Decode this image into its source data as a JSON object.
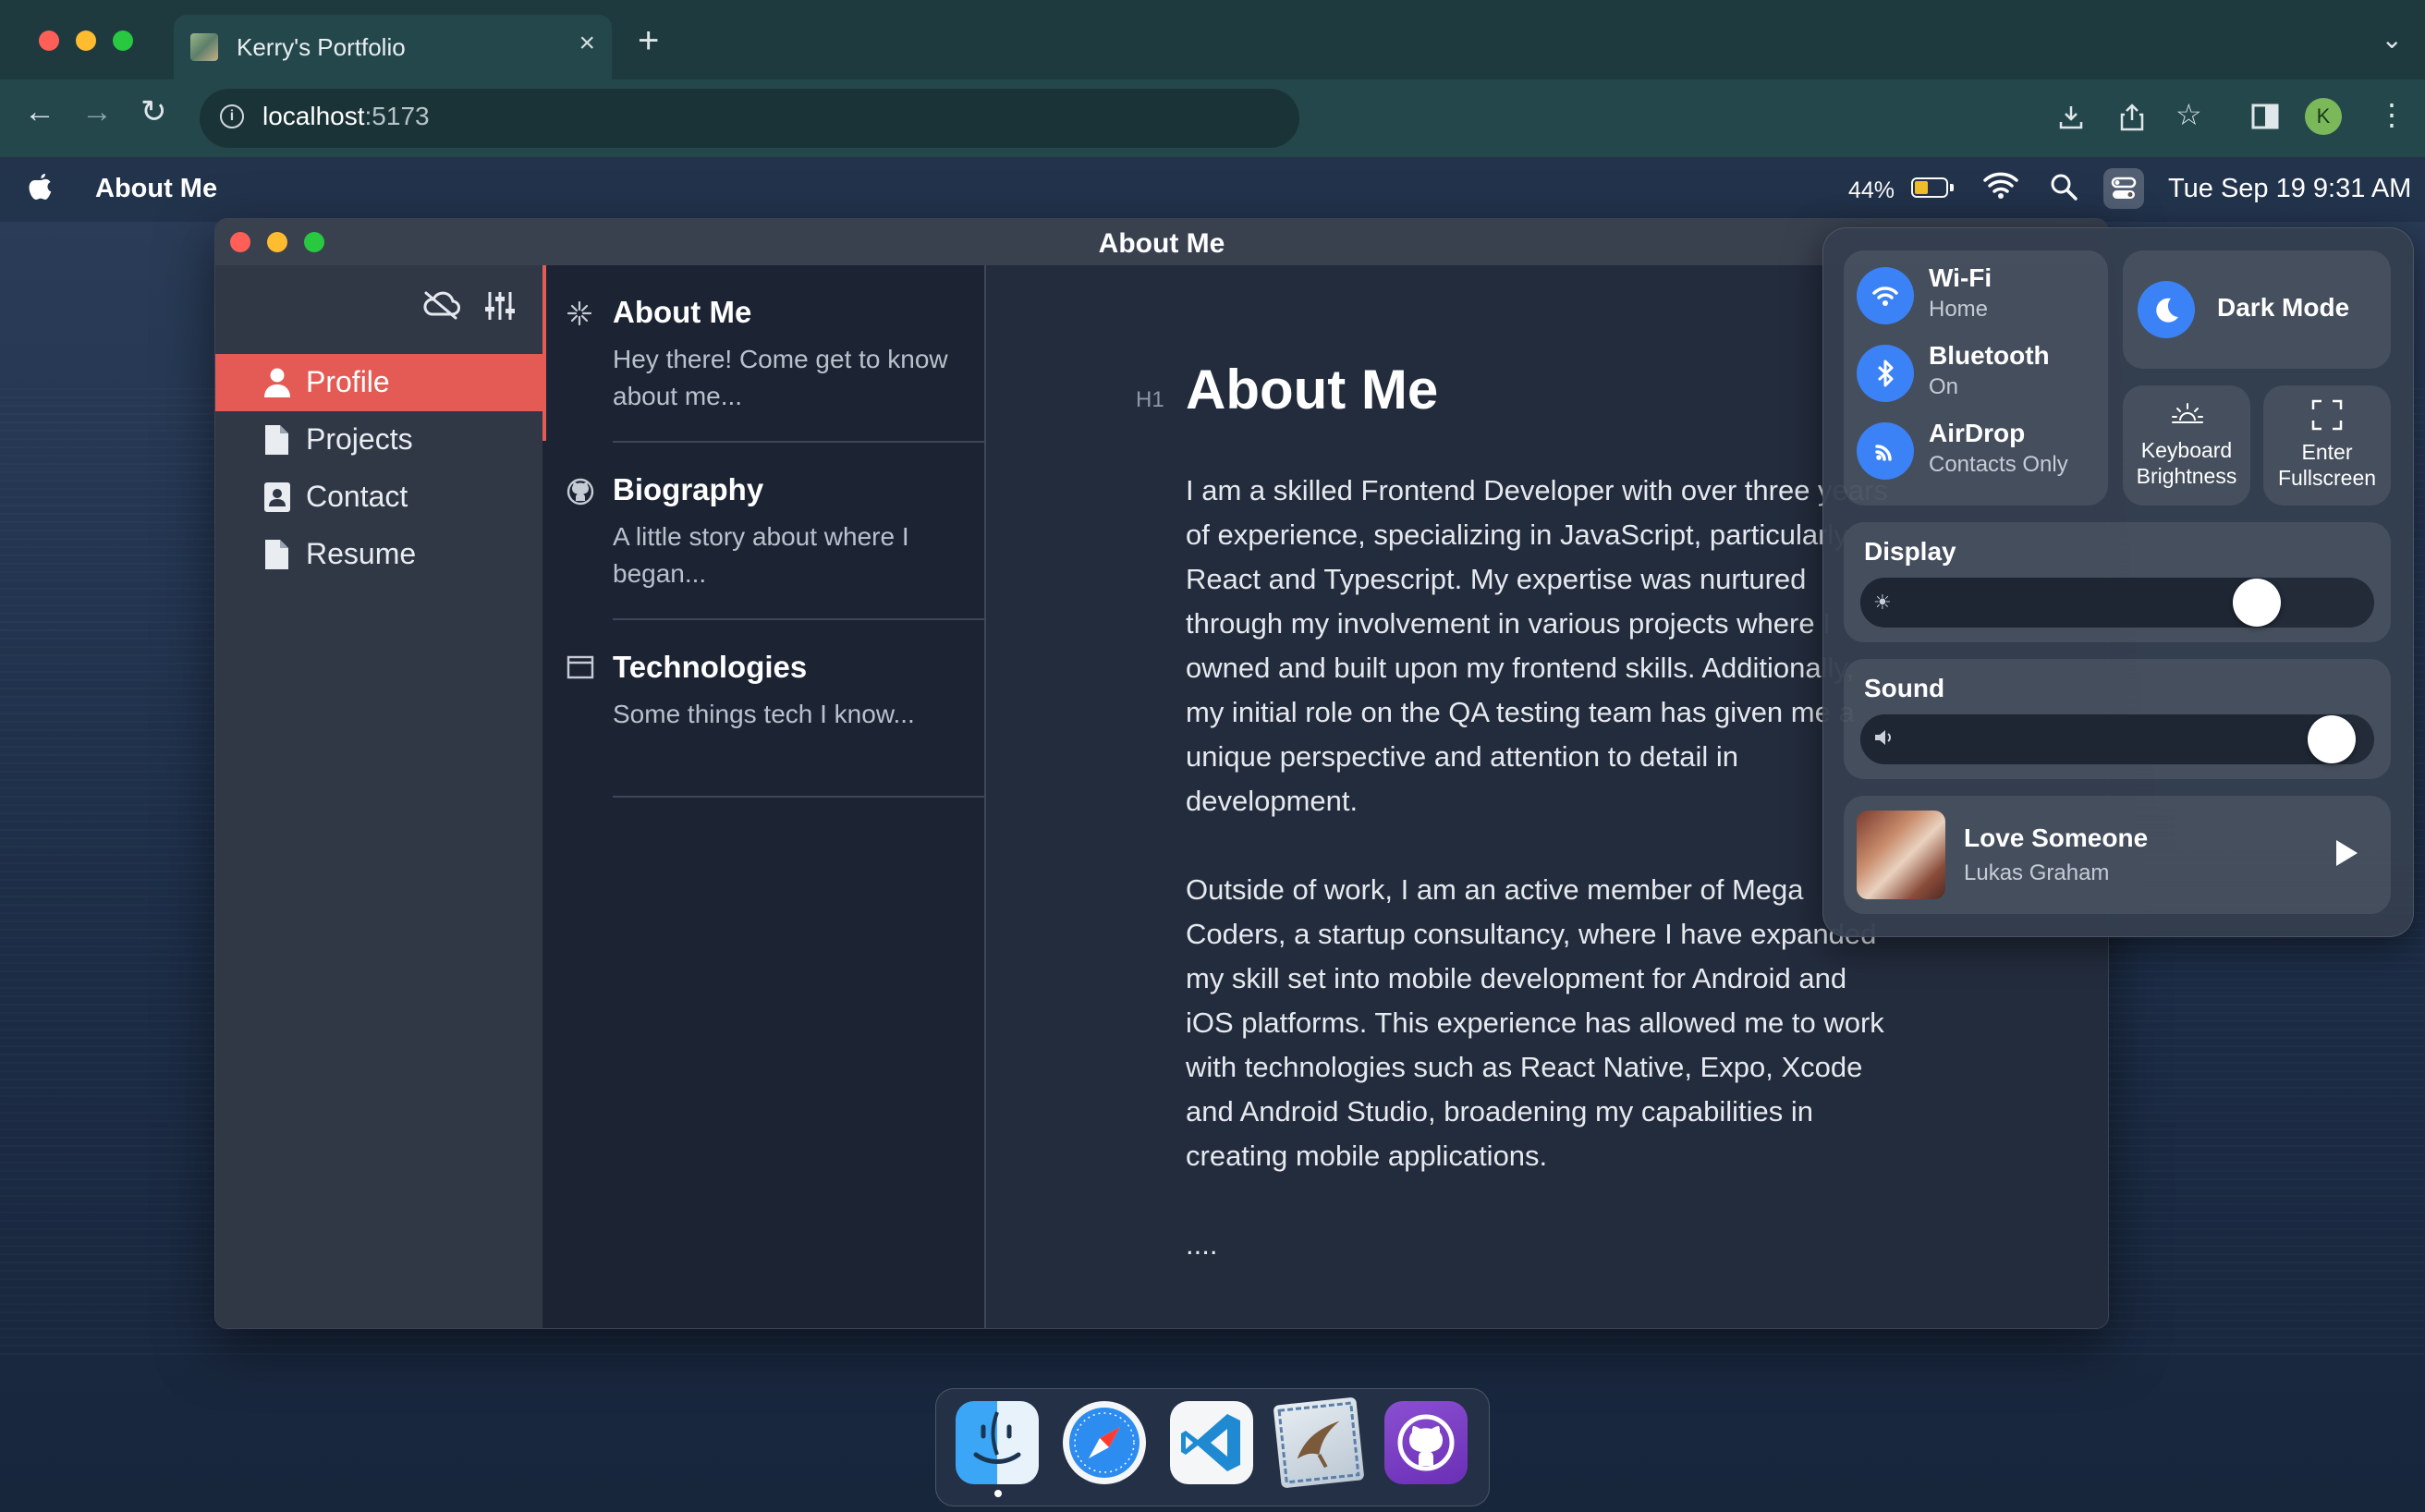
{
  "browser": {
    "tab_title": "Kerry's Portfolio",
    "url_host": "localhost",
    "url_port": ":5173",
    "profile_initial": "K"
  },
  "menubar": {
    "app_name": "About Me",
    "battery_percent": "44%",
    "battery_level": 0.44,
    "datetime": "Tue Sep 19 9:31 AM"
  },
  "window": {
    "title": "About Me",
    "sidebar": {
      "items": [
        {
          "label": "Profile",
          "icon": "user-icon",
          "active": true
        },
        {
          "label": "Projects",
          "icon": "document-icon",
          "active": false
        },
        {
          "label": "Contact",
          "icon": "contact-card-icon",
          "active": false
        },
        {
          "label": "Resume",
          "icon": "document-icon",
          "active": false
        }
      ]
    },
    "list": [
      {
        "title": "About Me",
        "description": "Hey there! Come get to know about me...",
        "icon": "sparkle-icon"
      },
      {
        "title": "Biography",
        "description": "A little story about where I began...",
        "icon": "github-icon"
      },
      {
        "title": "Technologies",
        "description": "Some things tech I know...",
        "icon": "window-icon"
      }
    ],
    "article": {
      "heading_marker": "H1",
      "title": "About Me",
      "paragraphs": [
        "I am a skilled Frontend Developer with over three years of experience, specializing in JavaScript, particularly React and Typescript. My expertise was nurtured through my involvement in various projects where I owned and built upon my frontend skills. Additionally, my initial role on the QA testing team has given me a unique perspective and attention to detail in development.",
        "Outside of work, I am an active member of Mega Coders, a startup consultancy, where I have expanded my skill set into mobile development for Android and iOS platforms. This experience has allowed me to work with technologies such as React Native, Expo, Xcode and Android Studio, broadening my capabilities in creating mobile applications.",
        "...."
      ]
    }
  },
  "control_center": {
    "connectivity": [
      {
        "name": "Wi-Fi",
        "status": "Home",
        "icon": "wifi-icon"
      },
      {
        "name": "Bluetooth",
        "status": "On",
        "icon": "bluetooth-icon"
      },
      {
        "name": "AirDrop",
        "status": "Contacts Only",
        "icon": "airdrop-icon"
      }
    ],
    "dark_mode_label": "Dark Mode",
    "keyboard_brightness_label": "Keyboard\nBrightness",
    "keyboard_brightness_line1": "Keyboard",
    "keyboard_brightness_line2": "Brightness",
    "fullscreen_line1": "Enter",
    "fullscreen_line2": "Fullscreen",
    "display_label": "Display",
    "display_level": 0.8,
    "sound_label": "Sound",
    "sound_level": 0.96,
    "now_playing": {
      "title": "Love Someone",
      "artist": "Lukas Graham"
    }
  },
  "dock": {
    "apps": [
      "finder-icon",
      "safari-icon",
      "vscode-icon",
      "mail-icon",
      "github-icon"
    ]
  },
  "colors": {
    "accent": "#e45a54",
    "control_blue": "#3b82f6"
  }
}
